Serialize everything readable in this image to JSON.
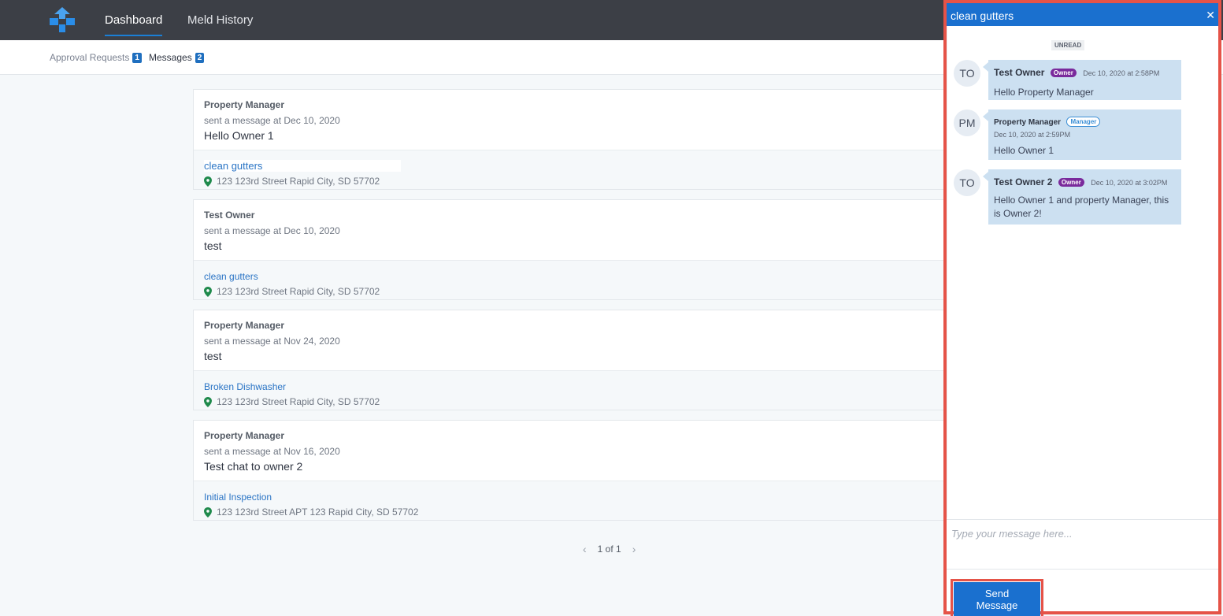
{
  "nav": {
    "tabs": [
      {
        "label": "Dashboard",
        "active": true
      },
      {
        "label": "Meld History",
        "active": false
      }
    ]
  },
  "subnav": {
    "approval": {
      "label": "Approval Requests",
      "count": "1"
    },
    "messages": {
      "label": "Messages",
      "count": "2"
    }
  },
  "cards": [
    {
      "sender": "Property Manager",
      "sent_at": "sent a message at Dec 10, 2020",
      "text": "Hello Owner 1",
      "meld": "clean gutters",
      "address": "123 123rd Street Rapid City, SD 57702"
    },
    {
      "sender": "Test Owner",
      "sent_at": "sent a message at Dec 10, 2020",
      "text": "test",
      "meld": "clean gutters",
      "address": "123 123rd Street Rapid City, SD 57702"
    },
    {
      "sender": "Property Manager",
      "sent_at": "sent a message at Nov 24, 2020",
      "text": "test",
      "meld": "Broken Dishwasher",
      "address": "123 123rd Street Rapid City, SD 57702"
    },
    {
      "sender": "Property Manager",
      "sent_at": "sent a message at Nov 16, 2020",
      "text": "Test chat to owner 2",
      "meld": "Initial Inspection",
      "address": "123 123rd Street APT 123 Rapid City, SD 57702"
    }
  ],
  "pager": {
    "prev": "‹",
    "label": "1 of 1",
    "next": "›"
  },
  "chat": {
    "title": "clean gutters",
    "close": "✕",
    "unread_label": "UNREAD",
    "messages": [
      {
        "initials": "TO",
        "name": "Test Owner",
        "tag": "Owner",
        "time": "Dec 10, 2020 at 2:58PM",
        "text": "Hello Property Manager"
      },
      {
        "initials": "PM",
        "name": "Property Manager",
        "tag": "Manager",
        "time": "Dec 10, 2020 at 2:59PM",
        "text": "Hello Owner 1"
      },
      {
        "initials": "TO",
        "name": "Test Owner 2",
        "tag": "Owner",
        "time": "Dec 10, 2020 at 3:02PM",
        "text": "Hello Owner 1 and property Manager, this is Owner 2!"
      }
    ],
    "input_placeholder": "Type your message here...",
    "send_label": "Send Message"
  },
  "colors": {
    "nav_bg": "#3c3f46",
    "accent": "#1a70cf",
    "highlight": "#e55348",
    "owner_tag": "#7a2a9c",
    "pin": "#1f8a4c"
  }
}
